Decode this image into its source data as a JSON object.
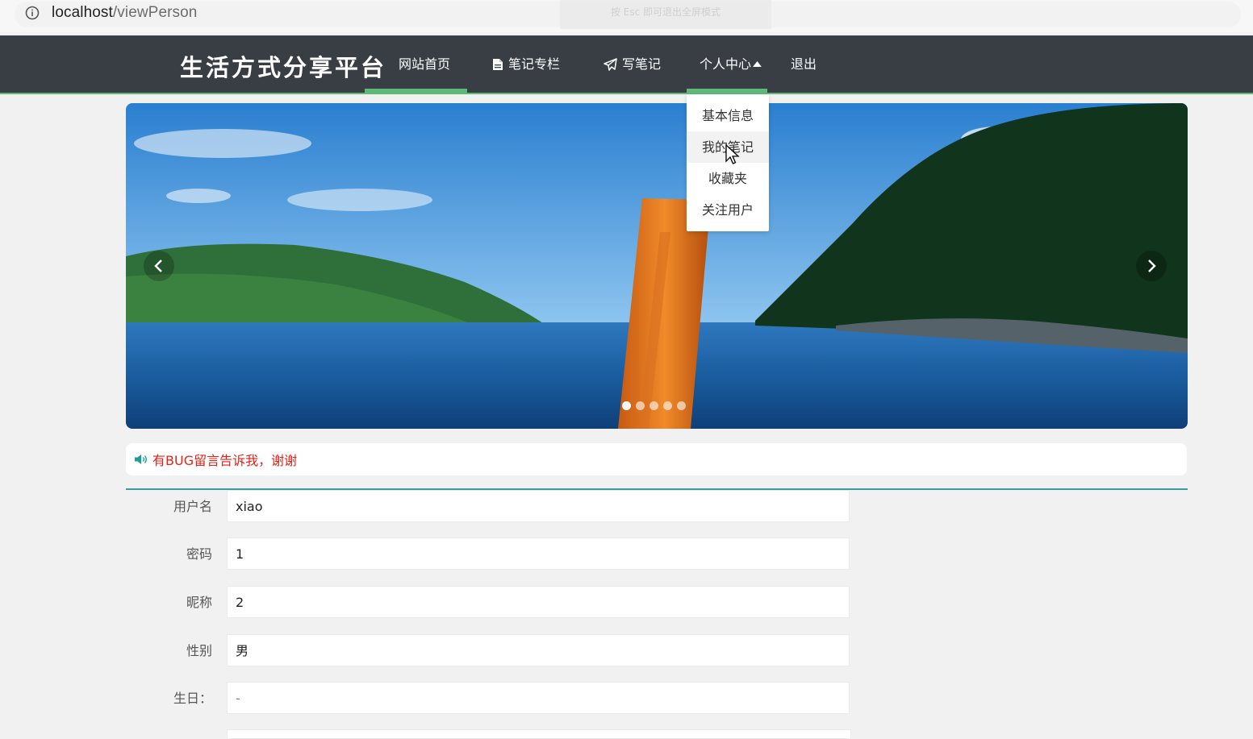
{
  "browser": {
    "url_host": "localhost",
    "url_path": "/viewPerson",
    "fullscreen_hint": "按 Esc 即可退出全屏模式"
  },
  "nav": {
    "brand": "生活方式分享平台",
    "items": [
      {
        "label": "网站首页",
        "icon": "none"
      },
      {
        "label": "笔记专栏",
        "icon": "file-icon"
      },
      {
        "label": "写笔记",
        "icon": "paper-plane-icon"
      },
      {
        "label": "个人中心",
        "icon": "caret-up-icon"
      },
      {
        "label": "退出",
        "icon": "none"
      }
    ],
    "active_color": "#5fb878",
    "bg_color": "#393d44"
  },
  "dropdown": {
    "items": [
      "基本信息",
      "我的笔记",
      "收藏夹",
      "关注用户"
    ]
  },
  "carousel": {
    "slide_count": 5,
    "active_index": 0,
    "prev_icon": "chevron-left-icon",
    "next_icon": "chevron-right-icon"
  },
  "notice": {
    "icon": "speaker-icon",
    "text": "有BUG留言告诉我，谢谢",
    "color": "#e2231a"
  },
  "form": {
    "fields": [
      {
        "label": "用户名",
        "value": "xiao"
      },
      {
        "label": "密码",
        "value": "1"
      },
      {
        "label": "昵称",
        "value": "2"
      },
      {
        "label": "性别",
        "value": "男"
      },
      {
        "label": "生日：",
        "value": "-"
      }
    ]
  }
}
